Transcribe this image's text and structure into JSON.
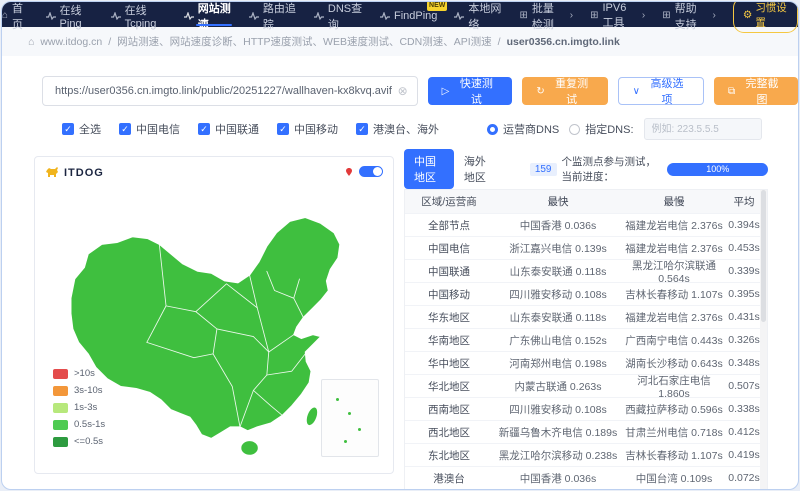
{
  "colors": {
    "accent": "#3370ff",
    "nav_bg": "#172243",
    "orange": "#f8a94d",
    "yellow": "#f5c842",
    "map_green": "#3fbf3f"
  },
  "nav": {
    "items": [
      {
        "label": "首页"
      },
      {
        "label": "在线Ping"
      },
      {
        "label": "在线Tcping"
      },
      {
        "label": "网站测速",
        "active": true
      },
      {
        "label": "路由追踪"
      },
      {
        "label": "DNS查询"
      },
      {
        "label": "FindPing",
        "badge": "NEW"
      },
      {
        "label": "本地网络"
      },
      {
        "label": "批量检测"
      },
      {
        "label": "IPV6工具"
      },
      {
        "label": "帮助支持"
      }
    ],
    "settings_label": "习惯设置"
  },
  "breadcrumb": {
    "site": "www.itdog.cn",
    "separator": "/",
    "path": "网站测速、网站速度诊断、HTTP速度测试、WEB速度测试、CDN测速、API测速",
    "current": "user0356.cn.imgto.link"
  },
  "toolbar": {
    "url_value": "https://user0356.cn.imgto.link/public/20251227/wallhaven-kx8kvq.avif",
    "quick_test": "快速测试",
    "repeat_test": "重复测试",
    "advanced_options": "高级选项",
    "full_screenshot": "完整截图"
  },
  "filters": {
    "checkboxes": [
      {
        "label": "全选",
        "checked": true
      },
      {
        "label": "中国电信",
        "checked": true
      },
      {
        "label": "中国联通",
        "checked": true
      },
      {
        "label": "中国移动",
        "checked": true
      },
      {
        "label": "港澳台、海外",
        "checked": true
      }
    ],
    "radio_isp_dns": "运营商DNS",
    "radio_custom_dns": "指定DNS:",
    "dns_placeholder": "例如: 223.5.5.5"
  },
  "map_panel": {
    "logo_text": "ITDOG",
    "legend": [
      {
        "label": ">10s",
        "color": "#e44c4c"
      },
      {
        "label": "3s-10s",
        "color": "#f3973a"
      },
      {
        "label": "1s-3s",
        "color": "#b7e87c"
      },
      {
        "label": "0.5s-1s",
        "color": "#4ecb52"
      },
      {
        "label": "<=0.5s",
        "color": "#2d9b3f"
      }
    ]
  },
  "results": {
    "tabs": [
      {
        "label": "中国地区",
        "active": true
      },
      {
        "label": "海外地区",
        "active": false
      }
    ],
    "monitor_count": "159",
    "monitor_text": "个监测点参与测试，当前进度：",
    "progress_label": "100%",
    "table": {
      "headers": [
        "区域/运营商",
        "最快",
        "最慢",
        "平均"
      ],
      "rows": [
        [
          "全部节点",
          "中国香港 0.036s",
          "福建龙岩电信 2.376s",
          "0.394s"
        ],
        [
          "中国电信",
          "浙江嘉兴电信 0.139s",
          "福建龙岩电信 2.376s",
          "0.453s"
        ],
        [
          "中国联通",
          "山东泰安联通 0.118s",
          "黑龙江哈尔滨联通 0.564s",
          "0.339s"
        ],
        [
          "中国移动",
          "四川雅安移动 0.108s",
          "吉林长春移动 1.107s",
          "0.395s"
        ],
        [
          "华东地区",
          "山东泰安联通 0.118s",
          "福建龙岩电信 2.376s",
          "0.431s"
        ],
        [
          "华南地区",
          "广东佛山电信 0.152s",
          "广西南宁电信 0.443s",
          "0.326s"
        ],
        [
          "华中地区",
          "河南郑州电信 0.198s",
          "湖南长沙移动 0.643s",
          "0.348s"
        ],
        [
          "华北地区",
          "内蒙古联通 0.263s",
          "河北石家庄电信 1.860s",
          "0.507s"
        ],
        [
          "西南地区",
          "四川雅安移动 0.108s",
          "西藏拉萨移动 0.596s",
          "0.338s"
        ],
        [
          "西北地区",
          "新疆乌鲁木齐电信 0.189s",
          "甘肃兰州电信 0.718s",
          "0.412s"
        ],
        [
          "东北地区",
          "黑龙江哈尔滨移动 0.238s",
          "吉林长春移动 1.107s",
          "0.419s"
        ],
        [
          "港澳台",
          "中国香港 0.036s",
          "中国台湾 0.109s",
          "0.072s"
        ]
      ]
    }
  }
}
